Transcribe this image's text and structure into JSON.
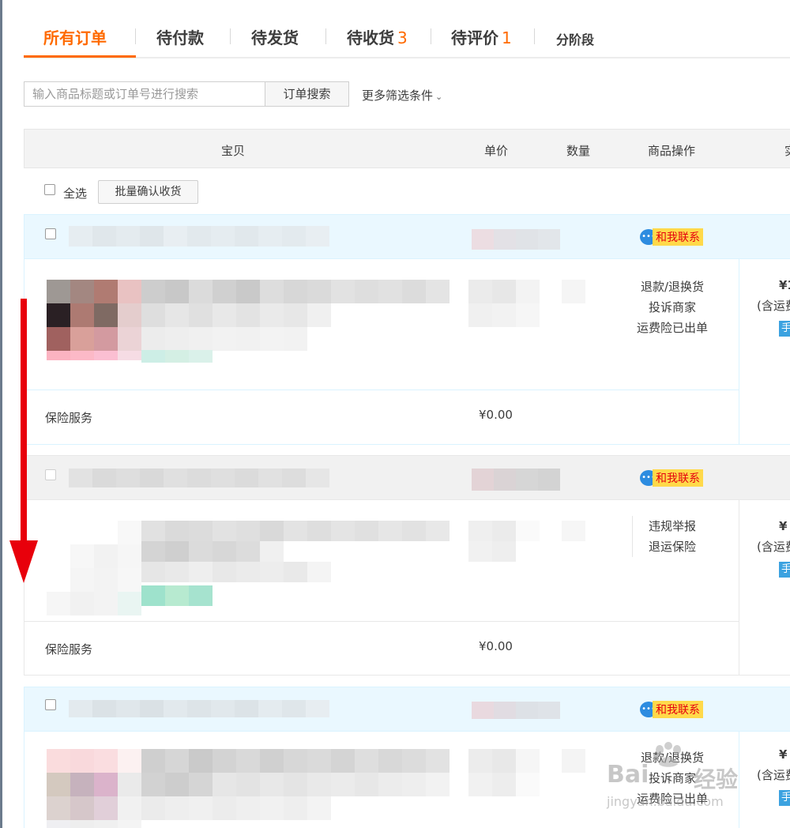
{
  "tabs": [
    {
      "label": "所有订单",
      "count": "",
      "active": true
    },
    {
      "label": "待付款",
      "count": ""
    },
    {
      "label": "待发货",
      "count": ""
    },
    {
      "label": "待收货",
      "count": "3"
    },
    {
      "label": "待评价",
      "count": "1"
    },
    {
      "label": "分阶段",
      "count": ""
    }
  ],
  "search": {
    "placeholder": "输入商品标题或订单号进行搜索",
    "button": "订单搜索",
    "more_filters": "更多筛选条件",
    "more_filters_icon": "chevron-down-icon"
  },
  "table_header": {
    "item": "宝贝",
    "unit_price": "单价",
    "quantity": "数量",
    "operations": "商品操作",
    "actual_paid": "实"
  },
  "select_all": {
    "label": "全选",
    "batch_confirm": "批量确认收货"
  },
  "orders": [
    {
      "contact": "和我联系",
      "operations": [
        "退款/退换货",
        "投诉商家",
        "运费险已出单"
      ],
      "price": "¥1",
      "shipping": "(含运费",
      "action": "手",
      "insurance_label": "保险服务",
      "insurance_price": "¥0.00"
    },
    {
      "contact": "和我联系",
      "operations": [
        "违规举报",
        "退运保险"
      ],
      "price": "¥",
      "shipping": "(含运费",
      "action": "手",
      "insurance_label": "保险服务",
      "insurance_price": "¥0.00"
    },
    {
      "contact": "和我联系",
      "operations": [
        "退款/退换货",
        "投诉商家",
        "运费险已出单"
      ],
      "price": "¥",
      "shipping": "(含运费",
      "action": "手"
    }
  ],
  "annotation": {
    "arrow_color": "#e8000b"
  },
  "watermark": {
    "brand": "Bai",
    "suffix": "经验",
    "url": "jingyan.baidu.com"
  },
  "colors": {
    "accent": "#ff6a00",
    "order_head_blue": "#eaf8ff",
    "order_head_grey": "#f1f1f1",
    "contact_badge": "#ffd94a"
  }
}
